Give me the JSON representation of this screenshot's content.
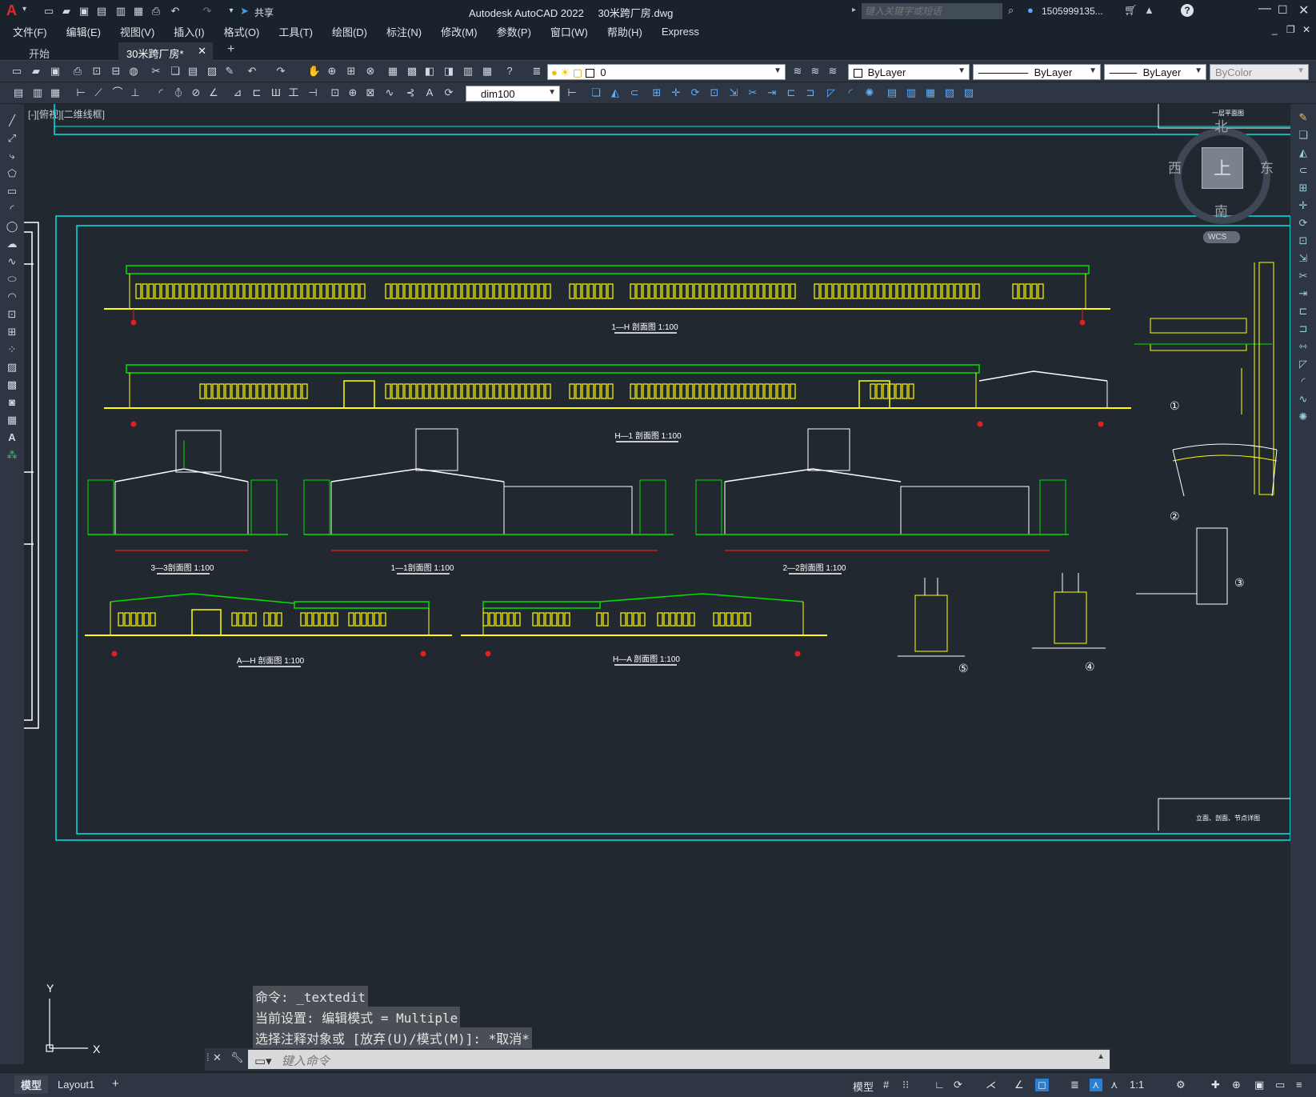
{
  "app": {
    "title": "Autodesk AutoCAD 2022",
    "file": "30米跨厂房.dwg",
    "share": "共享",
    "search_placeholder": "键入关键字或短语",
    "user": "1505999135...",
    "help": "?"
  },
  "menu": [
    "文件(F)",
    "编辑(E)",
    "视图(V)",
    "插入(I)",
    "格式(O)",
    "工具(T)",
    "绘图(D)",
    "标注(N)",
    "修改(M)",
    "参数(P)",
    "窗口(W)",
    "帮助(H)",
    "Express"
  ],
  "tabs": {
    "start": "开始",
    "file": "30米跨厂房*",
    "add": "+"
  },
  "layer": {
    "name": "0"
  },
  "properties": {
    "color": "ByLayer",
    "linetype": "ByLayer",
    "lineweight": "ByLayer",
    "plotstyle": "ByColor"
  },
  "dimstyle": "dim100",
  "viewport_label": "[-][俯视][二维线框]",
  "viewcube": {
    "top": "上",
    "n": "北",
    "s": "南",
    "e": "东",
    "w": "西",
    "wcs": "WCS"
  },
  "drawing": {
    "title_block_top": "一层平面图",
    "title_block_bottom": "立面、剖面、节点详图",
    "elevations": [
      "1—H 剖面图 1:100",
      "H—1 剖面图 1:100",
      "A—H 剖面图 1:100",
      "H—A 剖面图 1:100"
    ],
    "sections": [
      "3—3剖面图 1:100",
      "1—1剖面图 1:100",
      "2—2剖面图 1:100"
    ],
    "details": [
      "①",
      "②",
      "③",
      "④",
      "⑤"
    ]
  },
  "command": {
    "lines": [
      "命令: _textedit",
      "当前设置: 编辑模式 = Multiple",
      "选择注释对象或 [放弃(U)/模式(M)]: *取消*"
    ],
    "placeholder": "键入命令"
  },
  "ucs": {
    "y": "Y",
    "x": "X"
  },
  "layouts": {
    "model": "模型",
    "layout1": "Layout1",
    "add": "+"
  },
  "status": {
    "model": "模型",
    "scale": "1:1"
  },
  "colors": {
    "bg": "#212830",
    "panel": "#2d3642",
    "cyan": "#00e5e5",
    "yellow": "#ffff00",
    "green": "#00e000",
    "red": "#e02020",
    "white": "#ffffff"
  }
}
